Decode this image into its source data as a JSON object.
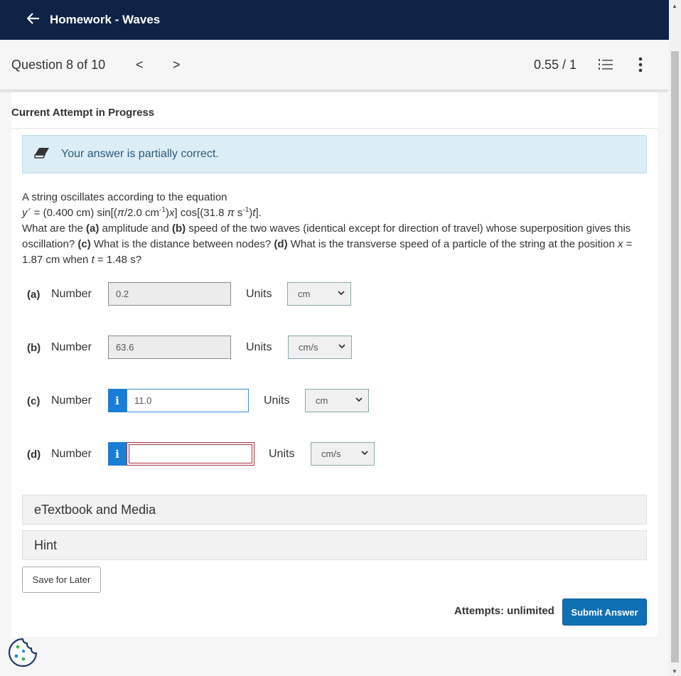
{
  "header": {
    "back_icon": "arrow-left-icon",
    "title": "Homework - Waves"
  },
  "qnav": {
    "label": "Question 8 of 10",
    "prev_glyph": "<",
    "next_glyph": ">",
    "score": "0.55 / 1",
    "list_icon": "numbered-list-icon",
    "more_icon": "vertical-ellipsis-icon"
  },
  "attempt": {
    "heading": "Current Attempt in Progress"
  },
  "feedback": {
    "icon": "eraser-icon",
    "message": "Your answer is partially correct."
  },
  "question": {
    "line1": "A string oscillates according to the equation",
    "eq_y": "y´",
    "eq_part1": " = (0.400 cm) sin[(",
    "eq_pi1": "π",
    "eq_part2": "/2.0 cm",
    "eq_sup1": "-1",
    "eq_part3": ")",
    "eq_x": "x",
    "eq_part4": "] cos[(31.8 ",
    "eq_pi2": "π",
    "eq_part5": " s",
    "eq_sup2": "-1",
    "eq_part6": ")",
    "eq_t": "t",
    "eq_part7": "].",
    "q_intro": "What are the ",
    "q_a": "(a)",
    "q_a_text": " amplitude and ",
    "q_b": "(b)",
    "q_b_text": " speed of the two waves (identical except for direction of travel) whose superposition gives this oscillation? ",
    "q_c": "(c)",
    "q_c_text": " What is the distance between nodes? ",
    "q_d": "(d)",
    "q_d_text": " What is the transverse speed of a particle of the string at the position ",
    "q_x": "x",
    "q_xval": " = 1.87 cm when ",
    "q_t": "t",
    "q_tval": " = 1.48 s?"
  },
  "answers": [
    {
      "part": "(a)",
      "number_label": "Number",
      "value": "0.2",
      "units_label": "Units",
      "unit": "cm"
    },
    {
      "part": "(b)",
      "number_label": "Number",
      "value": "63.6",
      "units_label": "Units",
      "unit": "cm/s"
    },
    {
      "part": "(c)",
      "number_label": "Number",
      "value": "11.0",
      "units_label": "Units",
      "unit": "cm",
      "info_glyph": "i"
    },
    {
      "part": "(d)",
      "number_label": "Number",
      "value": "",
      "units_label": "Units",
      "unit": "cm/s",
      "info_glyph": "i"
    }
  ],
  "accordions": {
    "etextbook": "eTextbook and Media",
    "hint": "Hint"
  },
  "actions": {
    "save_label": "Save for Later",
    "attempts_text": "Attempts: unlimited",
    "submit_label": "Submit Answer"
  },
  "footer": {
    "cookie_icon": "cookie-settings-icon"
  },
  "colors": {
    "header_bg": "#0f2346",
    "feedback_bg": "#dcedf6",
    "info_blue": "#1a7dd6",
    "submit_bg": "#116fb5",
    "error_red": "#a6323a"
  }
}
